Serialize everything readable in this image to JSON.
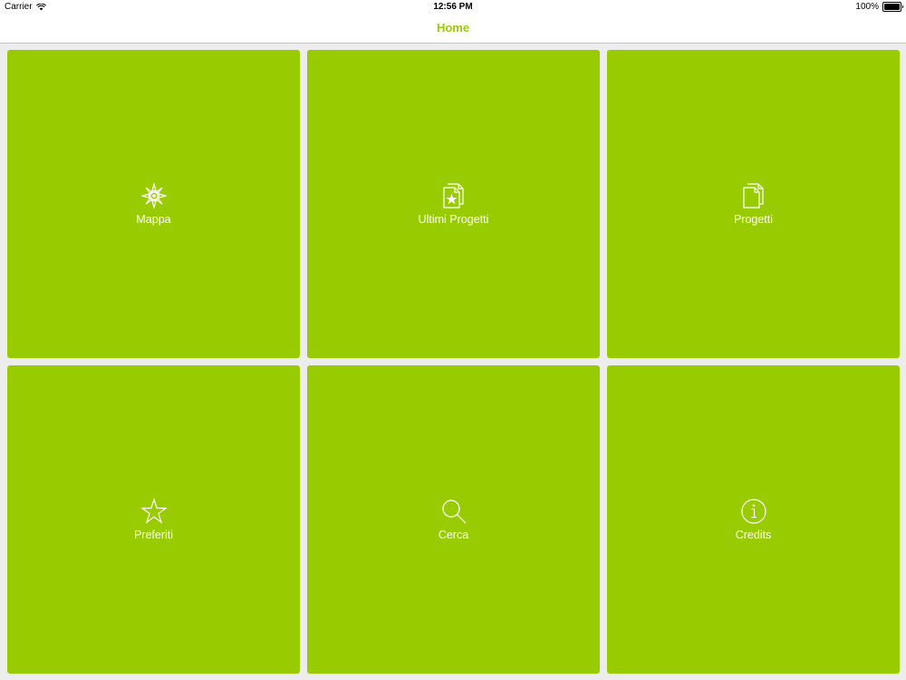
{
  "status_bar": {
    "carrier": "Carrier",
    "time": "12:56 PM",
    "battery": "100%"
  },
  "nav": {
    "title": "Home"
  },
  "colors": {
    "accent": "#99cc00",
    "tile_text": "#ffffff",
    "background": "#ededed"
  },
  "tiles": [
    {
      "label": "Mappa",
      "icon": "compass-icon"
    },
    {
      "label": "Ultimi Progetti",
      "icon": "starred-documents-icon"
    },
    {
      "label": "Progetti",
      "icon": "documents-icon"
    },
    {
      "label": "Preferiti",
      "icon": "star-icon"
    },
    {
      "label": "Cerca",
      "icon": "search-icon"
    },
    {
      "label": "Credits",
      "icon": "info-icon"
    }
  ]
}
